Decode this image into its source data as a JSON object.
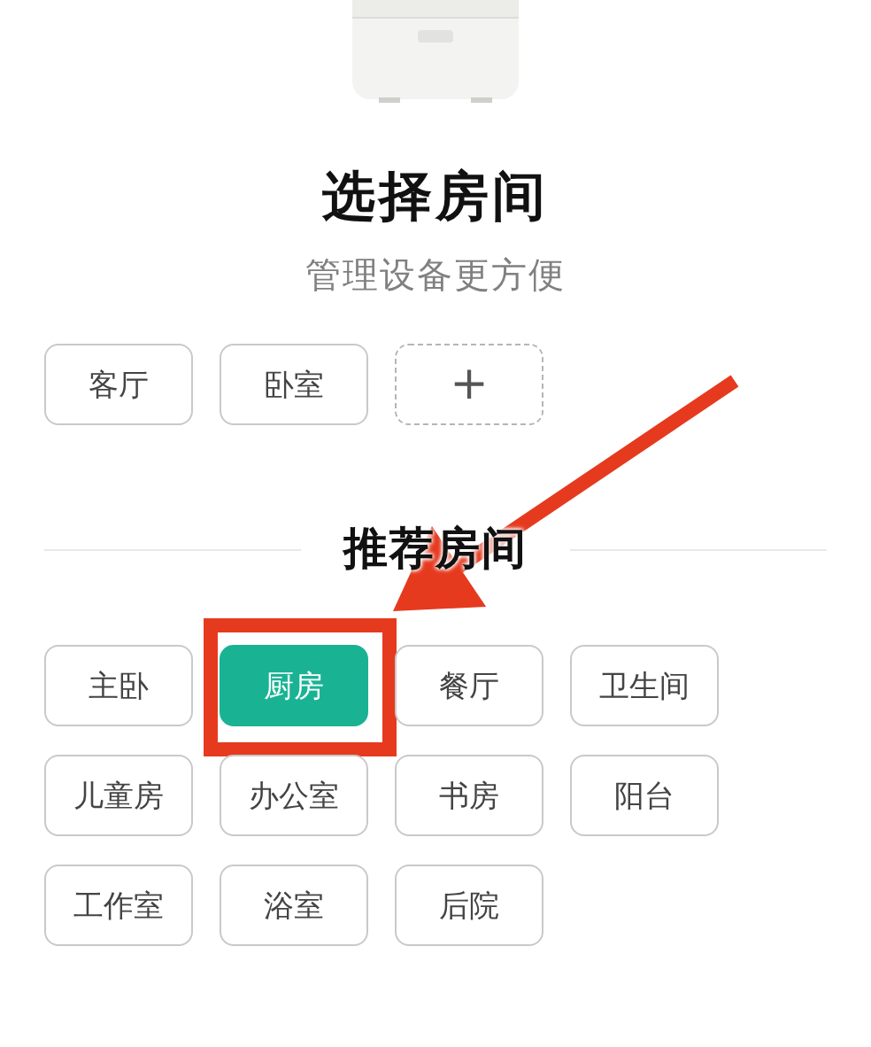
{
  "title": "选择房间",
  "subtitle": "管理设备更方便",
  "my_rooms": [
    {
      "label": "客厅"
    },
    {
      "label": "卧室"
    }
  ],
  "add_button": "+",
  "recommended_heading": "推荐房间",
  "recommended_rooms": [
    {
      "label": "主卧",
      "selected": false
    },
    {
      "label": "厨房",
      "selected": true
    },
    {
      "label": "餐厅",
      "selected": false
    },
    {
      "label": "卫生间",
      "selected": false
    },
    {
      "label": "儿童房",
      "selected": false
    },
    {
      "label": "办公室",
      "selected": false
    },
    {
      "label": "书房",
      "selected": false
    },
    {
      "label": "阳台",
      "selected": false
    },
    {
      "label": "工作室",
      "selected": false
    },
    {
      "label": "浴室",
      "selected": false
    },
    {
      "label": "后院",
      "selected": false
    }
  ]
}
